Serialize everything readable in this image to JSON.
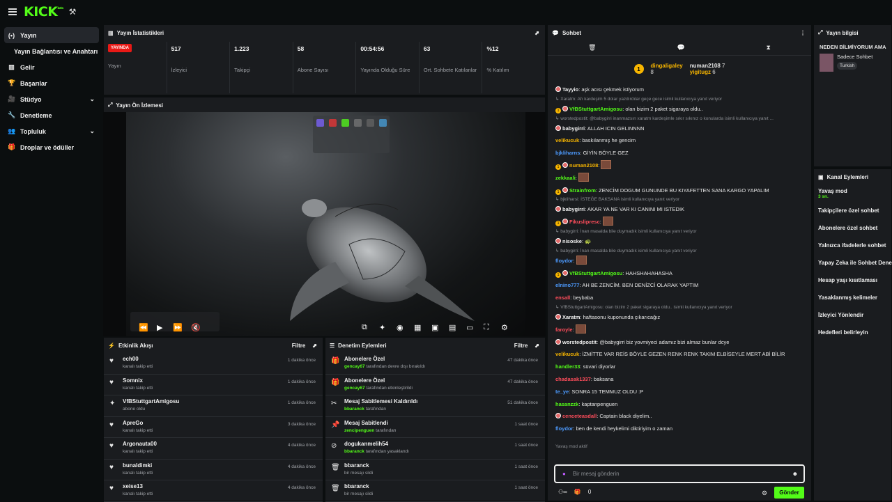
{
  "topbar": {
    "logo": "KICK",
    "logo_tag": "beta"
  },
  "sidebar": {
    "items": [
      {
        "icon": "(•)",
        "label": "Yayın",
        "active": true
      },
      {
        "icon": "",
        "label": "Yayın Bağlantısı ve Anahtarı"
      },
      {
        "icon": "▥",
        "label": "Gelir"
      },
      {
        "icon": "🏆",
        "label": "Başarılar"
      },
      {
        "icon": "🎥",
        "label": "Stüdyo",
        "chevron": "⌄"
      },
      {
        "icon": "🔧",
        "label": "Denetleme"
      },
      {
        "icon": "👥",
        "label": "Topluluk",
        "chevron": "⌄"
      },
      {
        "icon": "🎁",
        "label": "Droplar ve ödüller"
      }
    ]
  },
  "stats_panel": {
    "title": "Yayın İstatistikleri",
    "stats": [
      {
        "value": "YAYINDA",
        "label": "Yayın",
        "live": true
      },
      {
        "value": "517",
        "label": "İzleyici"
      },
      {
        "value": "1.223",
        "label": "Takipçi"
      },
      {
        "value": "58",
        "label": "Abone Sayısı"
      },
      {
        "value": "00:54:56",
        "label": "Yayında Olduğu Süre"
      },
      {
        "value": "63",
        "label": "Ort. Sohbete Katılanlar"
      },
      {
        "value": "%12",
        "label": "% Katılım"
      }
    ]
  },
  "preview_panel": {
    "title": "Yayın Ön İzlemesi"
  },
  "activity": {
    "title": "Etkinlik Akışı",
    "filter": "Filtre",
    "rows": [
      {
        "icon": "♥",
        "name": "ech00",
        "sub": "kanalı takip etti",
        "time": "1 dakika önce"
      },
      {
        "icon": "♥",
        "name": "Somnix",
        "sub": "kanalı takip etti",
        "time": "1 dakika önce"
      },
      {
        "icon": "✦",
        "name": "VfBStuttgartAmigosu",
        "sub": "abone oldu",
        "time": "1 dakika önce"
      },
      {
        "icon": "♥",
        "name": "ApreGo",
        "sub": "kanalı takip etti",
        "time": "3 dakika önce"
      },
      {
        "icon": "♥",
        "name": "Argonauta00",
        "sub": "kanalı takip etti",
        "time": "4 dakika önce"
      },
      {
        "icon": "♥",
        "name": "bunaldimki",
        "sub": "kanalı takip etti",
        "time": "4 dakika önce"
      },
      {
        "icon": "♥",
        "name": "xeise13",
        "sub": "kanalı takip etti",
        "time": "4 dakika önce"
      }
    ]
  },
  "moderation": {
    "title": "Denetim Eylemleri",
    "filter": "Filtre",
    "rows": [
      {
        "icon": "🎁",
        "name": "Abonelere Özel",
        "user": "gencay67",
        "sub": " tarafından devre dışı bırakıldı",
        "time": "47 dakika önce"
      },
      {
        "icon": "🎁",
        "name": "Abonelere Özel",
        "user": "gencay67",
        "sub": " tarafından etkinleştirildi",
        "time": "47 dakika önce"
      },
      {
        "icon": "✂",
        "name": "Mesaj Sabitlemesi Kaldırıldı",
        "user": "bbaranck",
        "sub": " tarafından",
        "time": "51 dakika önce"
      },
      {
        "icon": "📌",
        "name": "Mesaj Sabitlendi",
        "user": "zencipenguen",
        "sub": " tarafından",
        "time": "1 saat önce"
      },
      {
        "icon": "⊘",
        "name": "dogukanmelih54",
        "user": "bbaranck",
        "sub": " tarafından yasaklandı",
        "time": "1 saat önce"
      },
      {
        "icon": "🗑",
        "name": "bbaranck",
        "user": "",
        "sub": "bir mesajı sildi",
        "time": "1 saat önce"
      },
      {
        "icon": "🗑",
        "name": "bbaranck",
        "user": "",
        "sub": "bir mesajı sildi",
        "time": "1 saat önce"
      }
    ]
  },
  "chat": {
    "title": "Sohbet",
    "pinned": {
      "rank": "1",
      "user1": "dingaligaley",
      "count1": "8",
      "user2": "numan2108",
      "count2": "7",
      "user3": "yigitugz",
      "count3": "6"
    },
    "messages": [
      {
        "type": "msg",
        "user": "Tayyio",
        "color": "#f0f0f0",
        "text": "aşk acısı çekmek istiyorum",
        "ava": true
      },
      {
        "type": "reply",
        "text": "↳ Xaratm: Ah kardeşim 5 dolar yazdırdılar geçe gece isimli kullanıcıya yanıt veriyor"
      },
      {
        "type": "msg",
        "user": "VfBStuttgartAmigosu",
        "color": "#53fc18",
        "text": "olan bizim 2 paket sigaraya oldu..",
        "sub": true,
        "ava": true
      },
      {
        "type": "reply",
        "text": "↳ worstedpostit: @babygirri inanmazsın xaratm kardeşimle sıkır sıkınız o konularda isimli kullanıcıya yanıt ..."
      },
      {
        "type": "msg",
        "user": "babygirri",
        "color": "#f0f0f0",
        "text": "ALLAH ICIN GELINNNN",
        "ava": true
      },
      {
        "type": "msg",
        "user": "velikucuk",
        "color": "#f7b500",
        "text": "baskılanmış he gencim"
      },
      {
        "type": "msg",
        "user": "bjkliharns",
        "color": "#4d9bff",
        "text": "GİYİN BÖYLE GEZ"
      },
      {
        "type": "msg",
        "user": "numan2108",
        "color": "#f7b500",
        "text": "",
        "sub": true,
        "ava": true,
        "emote": true
      },
      {
        "type": "msg",
        "user": "zekkaali",
        "color": "#53fc18",
        "text": "",
        "emote": true
      },
      {
        "type": "msg",
        "user": "Strainfrom",
        "color": "#53fc18",
        "text": "ZENCİM DOGUM GUNUNDE BU KIYAFETTEN SANA KARGO YAPALIM",
        "sub": true,
        "ava": true
      },
      {
        "type": "reply",
        "text": "↳ bjkliharsi: İSTEĞE BAKSANA isimli kullanıcıya yanıt veriyor"
      },
      {
        "type": "msg",
        "user": "babygirri",
        "color": "#f0f0f0",
        "text": "AKAR YA NE VAR KI CANINI MI ISTEDIK",
        "ava": true
      },
      {
        "type": "msg",
        "user": "Fikuslipresc",
        "color": "#ff4d5b",
        "text": "",
        "sub": true,
        "ava": true,
        "emote": true
      },
      {
        "type": "reply",
        "text": "↳ babygirri: İnan masalda bile duymadık isimli kullanıcıya yanıt veriyor"
      },
      {
        "type": "msg",
        "user": "nisoske",
        "color": "#f0f0f0",
        "text": "🐢",
        "ava": true
      },
      {
        "type": "reply",
        "text": "↳ babygirri: İnan masalda bile duymadık isimli kullanıcıya yanıt veriyor"
      },
      {
        "type": "msg",
        "user": "floydor",
        "color": "#4d9bff",
        "text": "",
        "emote": true
      },
      {
        "type": "msg",
        "user": "VfBStuttgartAmigosu",
        "color": "#53fc18",
        "text": "HAHSHAHAHASHA",
        "sub": true,
        "ava": true
      },
      {
        "type": "msg",
        "user": "elnino777",
        "color": "#4d9bff",
        "text": "AH BE ZENCİM. BEN DENİZCİ OLARAK YAPTIM"
      },
      {
        "type": "msg",
        "user": "ensall",
        "color": "#ff4d5b",
        "text": "beybaba"
      },
      {
        "type": "reply",
        "text": "↳ VfBStuttgartAmigosu: olan bizim 2 paket sigaraya oldu.. isimli kullanıcıya yanıt veriyor"
      },
      {
        "type": "msg",
        "user": "Xaratm",
        "color": "#f0f0f0",
        "text": "haftasonu kuponunda çıkarıcağız",
        "ava": true
      },
      {
        "type": "msg",
        "user": "faroyle",
        "color": "#ff4d5b",
        "text": "",
        "emote": true
      },
      {
        "type": "msg",
        "user": "worstedpostit",
        "color": "#f0f0f0",
        "text": "@babygirri biz yovmiyeci adamız bizi almaz bunlar dcye",
        "ava": true
      },
      {
        "type": "msg",
        "user": "velikucuk",
        "color": "#f7b500",
        "text": "İZMİTTE VAR REİS BÖYLE GEZEN RENK RENK TAKIM ELBİSEYLE MERT ABİ BİLİR"
      },
      {
        "type": "msg",
        "user": "handler33",
        "color": "#53fc18",
        "text": "süvari diyorlar"
      },
      {
        "type": "msg",
        "user": "chadasak1337",
        "color": "#ff4d5b",
        "text": "baksana"
      },
      {
        "type": "msg",
        "user": "te_ye",
        "color": "#4d9bff",
        "text": "SONRA 15 TEMMUZ OLDU :P"
      },
      {
        "type": "msg",
        "user": "hasanzzk",
        "color": "#53fc18",
        "text": "kaptanpenguen"
      },
      {
        "type": "msg",
        "user": "cenceteasdall",
        "color": "#ff4d5b",
        "text": "Captain black diyelim..",
        "ava": true
      },
      {
        "type": "msg",
        "user": "floydor",
        "color": "#4d9bff",
        "text": "ben de kendi heykelimi diktiriyim o zaman"
      }
    ],
    "slow_mode": "Yavaş mod aktif",
    "input_placeholder": "Bir mesaj gönderin",
    "send": "Gönder",
    "footer_count": "0"
  },
  "stream_info": {
    "title": "Yayın bilgisi",
    "stream_title": "NEDEN BİLMİYORUM AMA",
    "category": "Sadece Sohbet",
    "tag": "Turkish"
  },
  "channel_actions": {
    "title": "Kanal Eylemleri",
    "items": [
      {
        "label": "Yavaş mod",
        "sub": "3 sn."
      },
      {
        "label": "Takipçilere özel sohbet",
        "sub": ""
      },
      {
        "label": "Abonelere özel sohbet",
        "sub": ""
      },
      {
        "label": "Yalnızca ifadelerle sohbet",
        "sub": ""
      },
      {
        "label": "Yapay Zeka ile Sohbet Dene",
        "sub": ""
      },
      {
        "label": "Hesap yaşı kısıtlaması",
        "sub": ""
      },
      {
        "label": "Yasaklanmış kelimeler",
        "sub": ""
      },
      {
        "label": "İzleyici Yönlendir",
        "sub": ""
      },
      {
        "label": "Hedefleri belirleyin",
        "sub": ""
      }
    ]
  },
  "colors": {
    "accent": "#53fc18",
    "live": "#e91916",
    "panel": "#1a1c1f",
    "bg": "#0b0e0f"
  }
}
